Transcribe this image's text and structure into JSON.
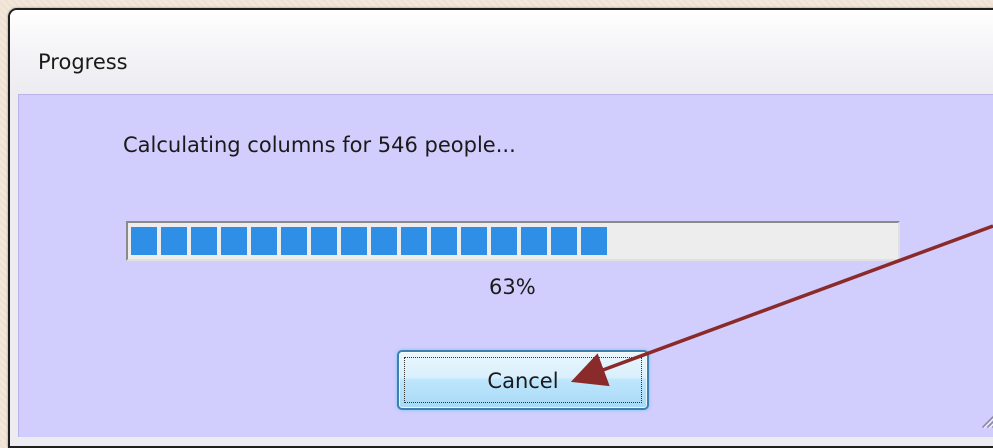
{
  "dialog": {
    "title": "Progress",
    "status_text": "Calculating columns for 546 people...",
    "progress_percent": 63,
    "percent_label": "63%",
    "cancel_label": "Cancel"
  },
  "colors": {
    "client_background": "#d1cdfc",
    "progress_fill": "#2f8fe6",
    "annotation_arrow": "#8b2a2a"
  },
  "icons": [
    "size-grip-icon",
    "annotation-arrow"
  ]
}
